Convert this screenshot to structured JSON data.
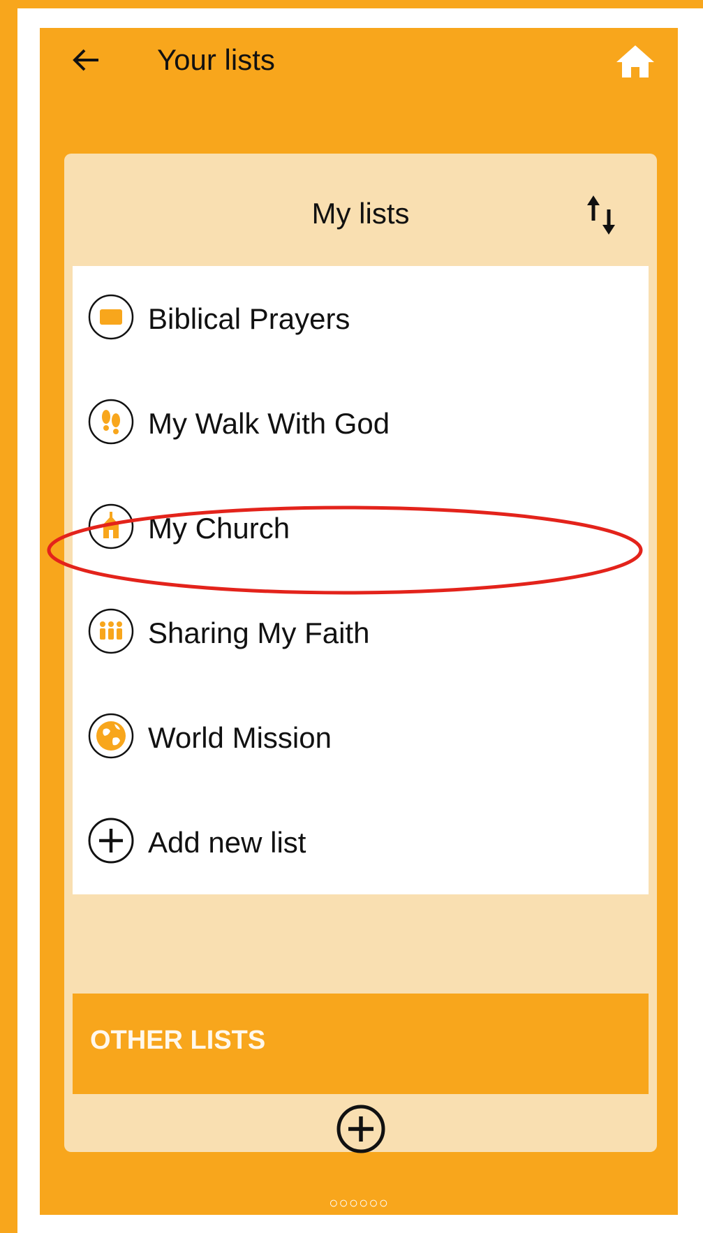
{
  "header": {
    "title": "Your lists",
    "back_icon": "arrow-left-icon",
    "home_icon": "home-icon"
  },
  "card": {
    "title": "My lists",
    "sort_icon": "sort-arrows-icon"
  },
  "lists": [
    {
      "label": "Biblical Prayers",
      "icon": "bible-book-icon"
    },
    {
      "label": "My Walk With God",
      "icon": "footprints-icon"
    },
    {
      "label": "My Church",
      "icon": "church-icon",
      "highlighted": true
    },
    {
      "label": "Sharing My Faith",
      "icon": "people-icon"
    },
    {
      "label": "World Mission",
      "icon": "globe-icon"
    },
    {
      "label": "Add new list",
      "icon": "plus-circle-icon"
    }
  ],
  "other_lists": {
    "label": "OTHER LISTS"
  },
  "pager": {
    "dots": "○○○○○○"
  },
  "colors": {
    "accent": "#f8a61c",
    "card_bg": "#f9dfb1",
    "highlight": "#e3231b"
  }
}
